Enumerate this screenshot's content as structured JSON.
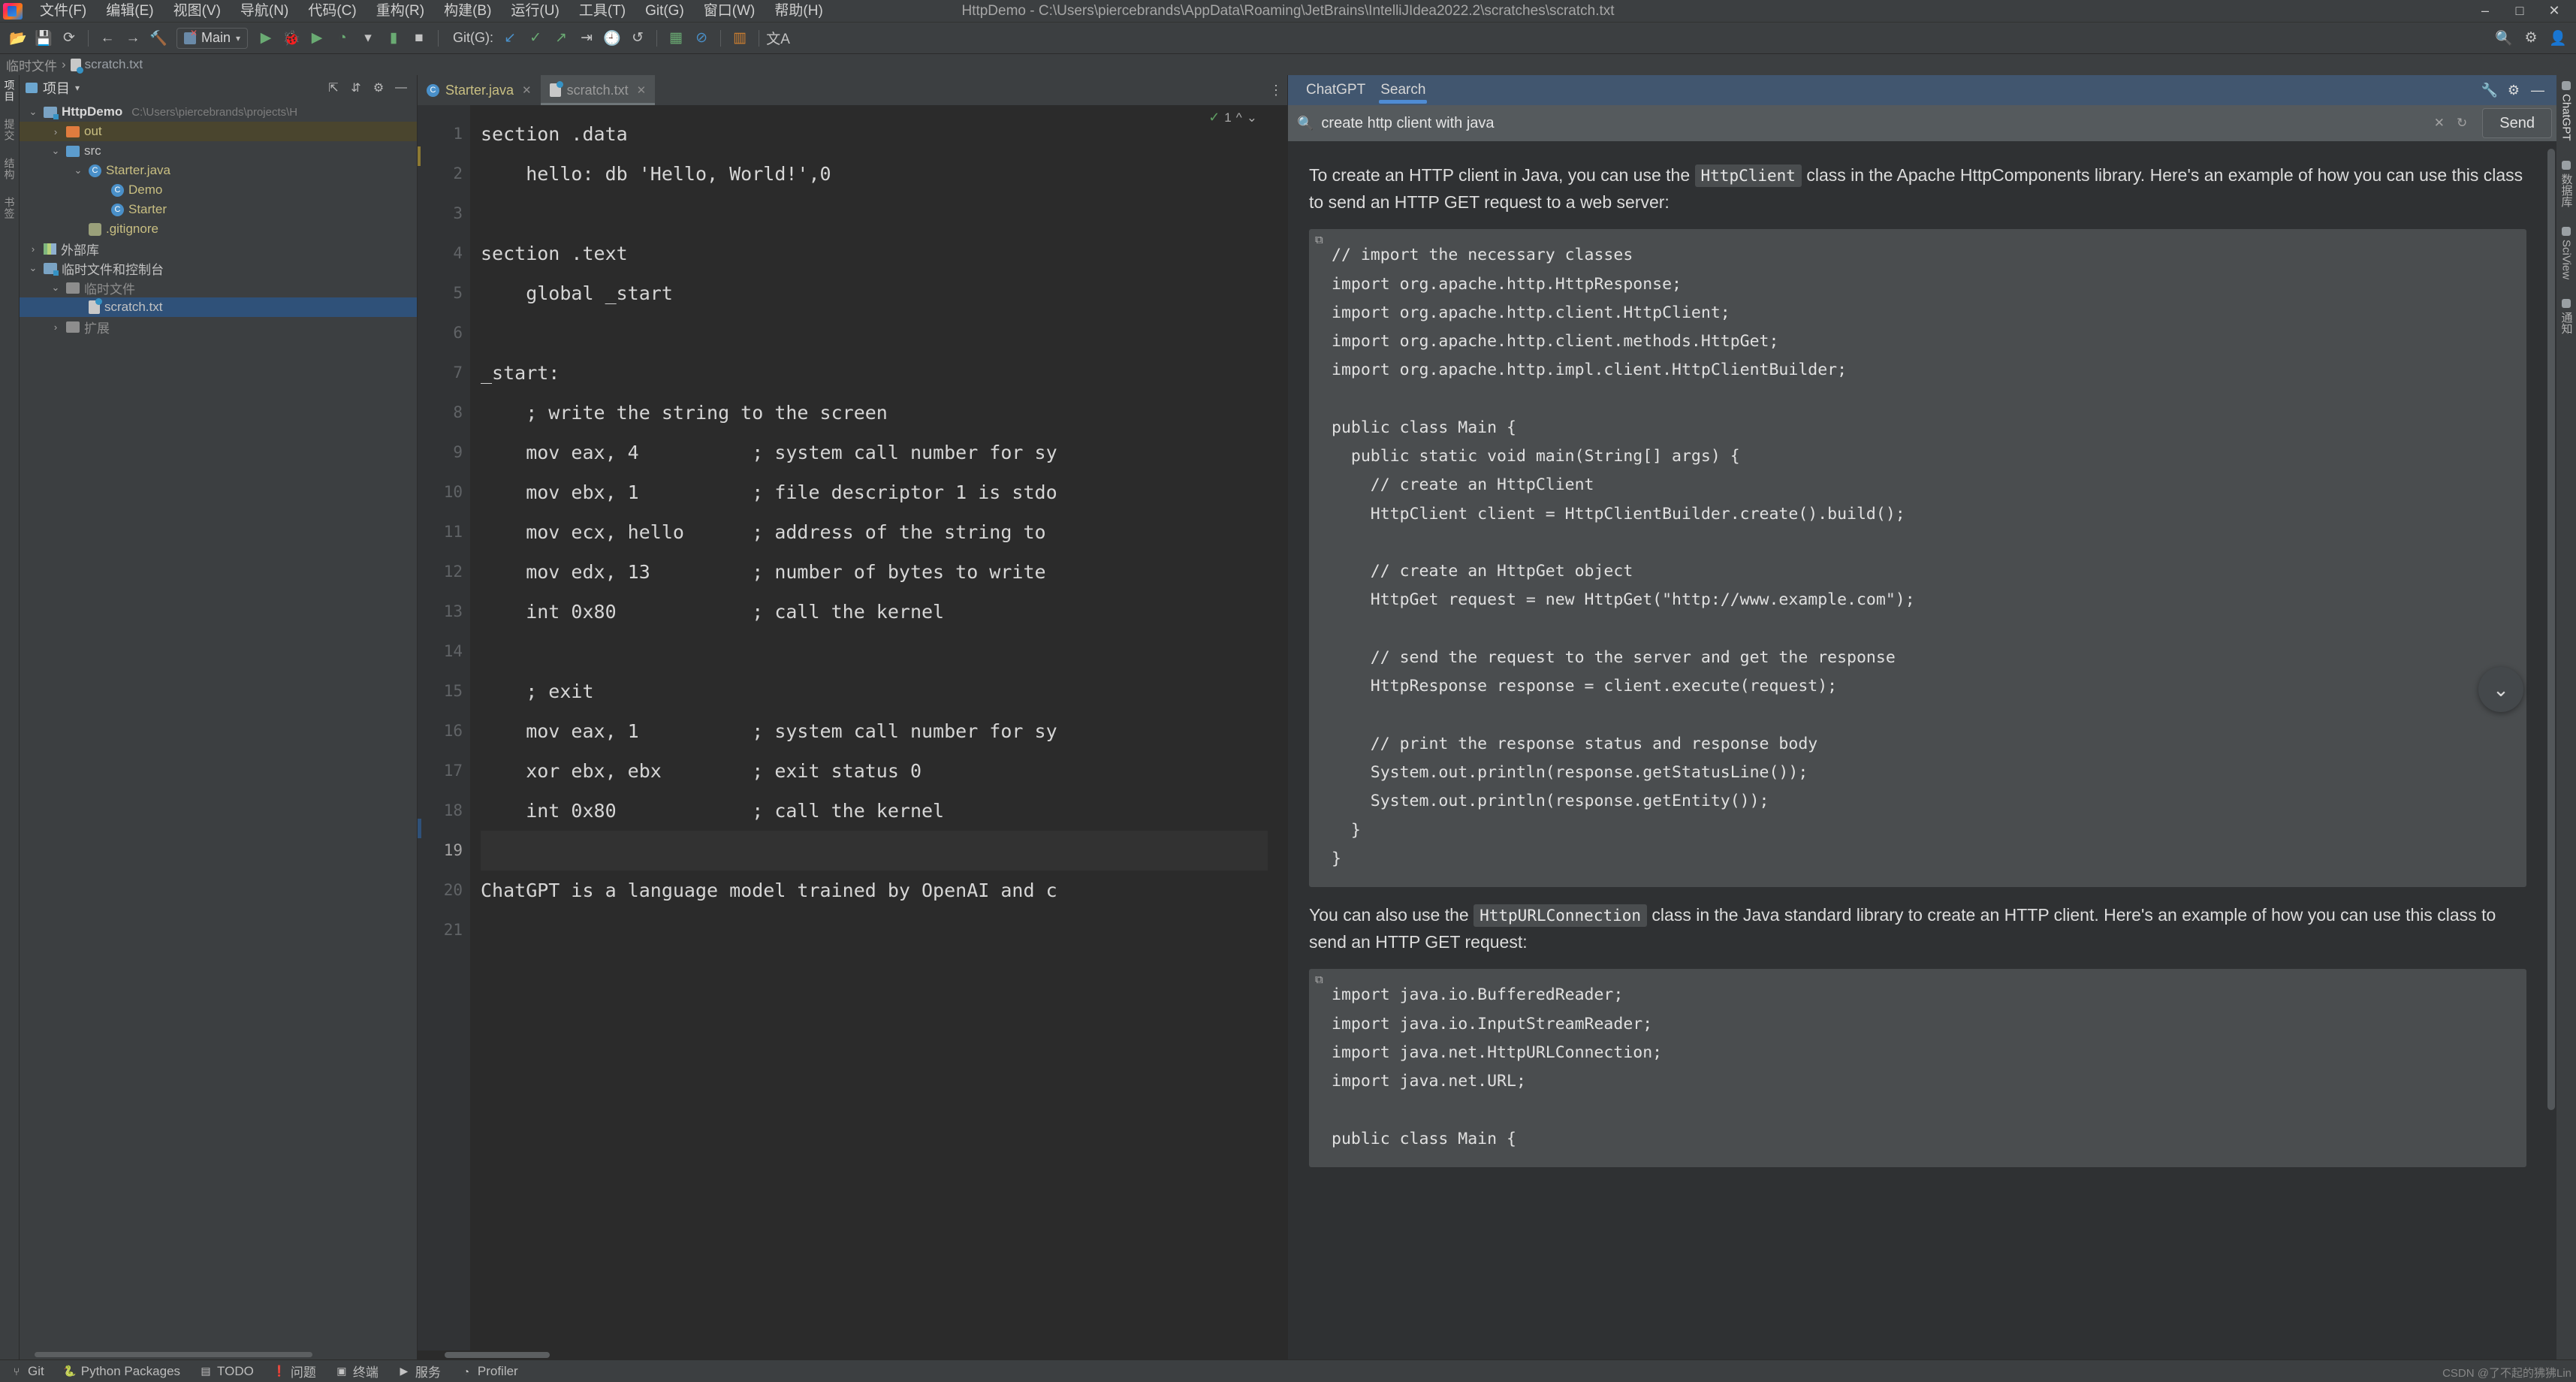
{
  "window": {
    "title": "HttpDemo - C:\\Users\\piercebrands\\AppData\\Roaming\\JetBrains\\IntelliJIdea2022.2\\scratches\\scratch.txt",
    "minimize": "–",
    "maximize": "□",
    "close": "✕"
  },
  "menu": {
    "items": [
      "文件(F)",
      "编辑(E)",
      "视图(V)",
      "导航(N)",
      "代码(C)",
      "重构(R)",
      "构建(B)",
      "运行(U)",
      "工具(T)",
      "Git(G)",
      "窗口(W)",
      "帮助(H)"
    ]
  },
  "toolbar": {
    "open_icon": "📂",
    "save_icon": "💾",
    "sync_icon": "⟳",
    "back_icon": "←",
    "forward_icon": "→",
    "build_icon": "🔨",
    "run_config": "Main",
    "run_icon": "▶",
    "debug_icon": "🐞",
    "coverage_icon": "▶",
    "profile_icon": "◔",
    "dropdown_icon": "▾",
    "more_run_icon": "▮",
    "stop_icon": "■",
    "git_label": "Git(G):",
    "git_update_icon": "↙",
    "git_commit_icon": "✓",
    "git_push_icon": "↗",
    "git_shelve_icon": "⇥",
    "git_history_icon": "🕘",
    "git_rollback_icon": "↺",
    "chart_icon": "▦",
    "block_icon": "⊘",
    "ui_icon": "▥",
    "translate_icon": "文A",
    "search_everywhere_icon": "🔍",
    "settings_icon": "⚙",
    "account_icon": "👤"
  },
  "breadcrumb": {
    "root": "临时文件",
    "separator": "›",
    "file": "scratch.txt"
  },
  "left_rail": {
    "items": [
      "项目",
      "提交",
      "结构",
      "书签"
    ]
  },
  "project_panel": {
    "title": "项目",
    "caret": "▾",
    "tools": [
      "⇱",
      "⇵",
      "⚙",
      "—"
    ],
    "tree": [
      {
        "indent": 0,
        "twist": "⌄",
        "icon": "module",
        "label": "HttpDemo",
        "bold": true,
        "path": "C:\\Users\\piercebrands\\projects\\H",
        "state": "normal"
      },
      {
        "indent": 1,
        "twist": "›",
        "icon": "folder-orange",
        "label": "out",
        "bold": false,
        "path": "",
        "state": "highlight"
      },
      {
        "indent": 1,
        "twist": "⌄",
        "icon": "folder-blue",
        "label": "src",
        "bold": false,
        "path": "",
        "state": "normal"
      },
      {
        "indent": 2,
        "twist": "⌄",
        "icon": "class-run",
        "label": "Starter.java",
        "bold": false,
        "path": "",
        "state": "normal"
      },
      {
        "indent": 3,
        "twist": "",
        "icon": "class",
        "label": "Demo",
        "bold": false,
        "path": "",
        "state": "normal"
      },
      {
        "indent": 3,
        "twist": "",
        "icon": "class-run",
        "label": "Starter",
        "bold": false,
        "path": "",
        "state": "normal"
      },
      {
        "indent": 2,
        "twist": "",
        "icon": "git",
        "label": ".gitignore",
        "bold": false,
        "path": "",
        "state": "normal"
      },
      {
        "indent": 0,
        "twist": "›",
        "icon": "lib",
        "label": "外部库",
        "bold": false,
        "path": "",
        "state": "normal"
      },
      {
        "indent": 0,
        "twist": "⌄",
        "icon": "module",
        "label": "临时文件和控制台",
        "bold": false,
        "path": "",
        "state": "normal"
      },
      {
        "indent": 1,
        "twist": "⌄",
        "icon": "folder",
        "label": "临时文件",
        "bold": false,
        "path": "",
        "state": "dim"
      },
      {
        "indent": 2,
        "twist": "",
        "icon": "scratch",
        "label": "scratch.txt",
        "bold": false,
        "path": "",
        "state": "selected"
      },
      {
        "indent": 1,
        "twist": "›",
        "icon": "folder",
        "label": "扩展",
        "bold": false,
        "path": "",
        "state": "dim"
      }
    ]
  },
  "editor": {
    "tabs": [
      {
        "label": "Starter.java",
        "icon": "java-class-icon",
        "active": false,
        "close": "✕"
      },
      {
        "label": "scratch.txt",
        "icon": "scratch-icon",
        "active": true,
        "close": "✕"
      }
    ],
    "more_icon": "⋮",
    "inspection": {
      "check": "✓",
      "count": "1",
      "up": "^",
      "down": "⌄"
    },
    "line_numbers": [
      "1",
      "2",
      "3",
      "4",
      "5",
      "6",
      "7",
      "8",
      "9",
      "10",
      "11",
      "12",
      "13",
      "14",
      "15",
      "16",
      "17",
      "18",
      "19",
      "20",
      "21"
    ],
    "current_line": 19,
    "lines": [
      "section .data",
      "    hello: db 'Hello, World!',0",
      "",
      "section .text",
      "    global _start",
      "",
      "_start:",
      "    ; write the string to the screen",
      "    mov eax, 4          ; system call number for sy",
      "    mov ebx, 1          ; file descriptor 1 is stdo",
      "    mov ecx, hello      ; address of the string to ",
      "    mov edx, 13         ; number of bytes to write",
      "    int 0x80            ; call the kernel",
      "",
      "    ; exit",
      "    mov eax, 1          ; system call number for sy",
      "    xor ebx, ebx        ; exit status 0",
      "    int 0x80            ; call the kernel",
      "",
      "ChatGPT is a language model trained by OpenAI and c",
      ""
    ]
  },
  "chat": {
    "tabs": [
      {
        "label": "ChatGPT",
        "active": false
      },
      {
        "label": "Search",
        "active": true
      }
    ],
    "tools": [
      "🔧",
      "⚙",
      "—"
    ],
    "search": {
      "icon": "🔍",
      "value": "create http client with java",
      "placeholder": "create http client with java",
      "clear_icon": "✕",
      "reset_icon": "↻",
      "send_label": "Send"
    },
    "scroll_down_icon": "⌄",
    "blocks": [
      {
        "type": "paragraph",
        "segments": [
          {
            "text": "To create an HTTP client in Java, you can use the ",
            "code": false
          },
          {
            "text": "HttpClient",
            "code": true
          },
          {
            "text": " class in the Apache HttpComponents library. Here's an example of how you can use this class to send an HTTP GET request to a web server:",
            "code": false
          }
        ]
      },
      {
        "type": "code",
        "copy_icon": "⧉",
        "text": "// import the necessary classes\nimport org.apache.http.HttpResponse;\nimport org.apache.http.client.HttpClient;\nimport org.apache.http.client.methods.HttpGet;\nimport org.apache.http.impl.client.HttpClientBuilder;\n\npublic class Main {\n  public static void main(String[] args) {\n    // create an HttpClient\n    HttpClient client = HttpClientBuilder.create().build();\n\n    // create an HttpGet object\n    HttpGet request = new HttpGet(\"http://www.example.com\");\n\n    // send the request to the server and get the response\n    HttpResponse response = client.execute(request);\n\n    // print the response status and response body\n    System.out.println(response.getStatusLine());\n    System.out.println(response.getEntity());\n  }\n}"
      },
      {
        "type": "paragraph",
        "segments": [
          {
            "text": "You can also use the ",
            "code": false
          },
          {
            "text": "HttpURLConnection",
            "code": true
          },
          {
            "text": " class in the Java standard library to create an HTTP client. Here's an example of how you can use this class to send an HTTP GET request:",
            "code": false
          }
        ]
      },
      {
        "type": "code",
        "copy_icon": "⧉",
        "text": "import java.io.BufferedReader;\nimport java.io.InputStreamReader;\nimport java.net.HttpURLConnection;\nimport java.net.URL;\n\npublic class Main {"
      }
    ]
  },
  "right_rail": {
    "items": [
      {
        "label": "ChatGPT",
        "active": true
      },
      {
        "label": "数据库",
        "active": false
      },
      {
        "label": "SciView",
        "active": false
      },
      {
        "label": "通知",
        "active": false
      }
    ]
  },
  "status_bar": {
    "items": [
      {
        "icon": "⑂",
        "label": "Git"
      },
      {
        "icon": "🐍",
        "label": "Python Packages"
      },
      {
        "icon": "▤",
        "label": "TODO"
      },
      {
        "icon": "❗",
        "label": "问题"
      },
      {
        "icon": "▣",
        "label": "终端"
      },
      {
        "icon": "▶",
        "label": "服务"
      },
      {
        "icon": "◔",
        "label": "Profiler"
      }
    ],
    "watermark": "CSDN @了不起的狒狒Lin"
  }
}
